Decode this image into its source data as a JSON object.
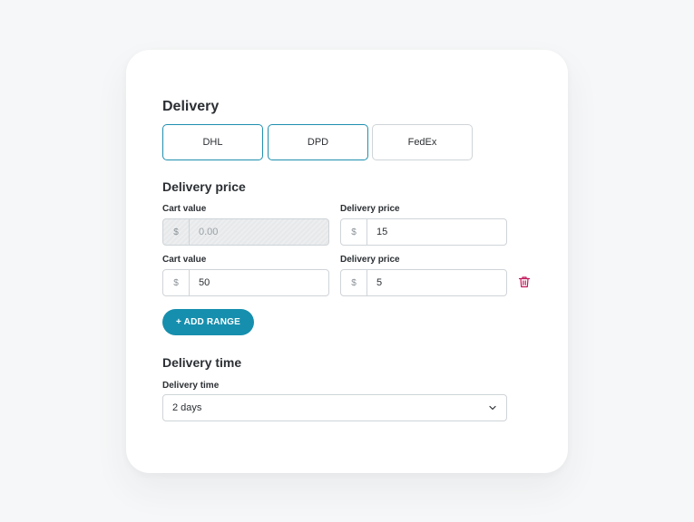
{
  "delivery": {
    "title": "Delivery",
    "carriers": [
      {
        "label": "DHL",
        "selected": true
      },
      {
        "label": "DPD",
        "selected": true
      },
      {
        "label": "FedEx",
        "selected": false
      }
    ]
  },
  "price_section": {
    "title": "Delivery price",
    "ranges": [
      {
        "cart_label": "Cart value",
        "cart_prefix": "$",
        "cart_value": "0.00",
        "cart_disabled": true,
        "price_label": "Delivery price",
        "price_prefix": "$",
        "price_value": "15",
        "removable": false
      },
      {
        "cart_label": "Cart value",
        "cart_prefix": "$",
        "cart_value": "50",
        "cart_disabled": false,
        "price_label": "Delivery price",
        "price_prefix": "$",
        "price_value": "5",
        "removable": true
      }
    ],
    "add_button": "+ ADD RANGE",
    "delete_icon": "trash-icon"
  },
  "time_section": {
    "title": "Delivery time",
    "field_label": "Delivery time",
    "selected": "2 days",
    "icon": "chevron-down-icon"
  },
  "colors": {
    "accent": "#168fae",
    "selected_border": "#1f8fae",
    "danger": "#c2185b"
  }
}
